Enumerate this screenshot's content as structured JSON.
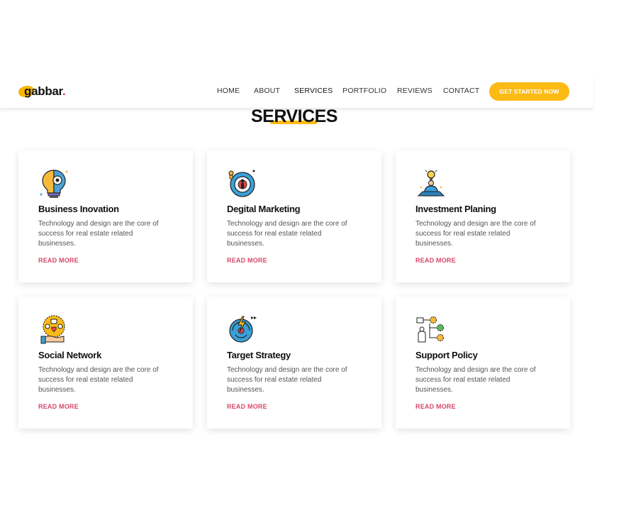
{
  "brand": {
    "name": "gabbar",
    "dot": ".",
    "accent": "#fcbb14"
  },
  "nav": {
    "items": [
      {
        "label": "HOME"
      },
      {
        "label": "ABOUT"
      },
      {
        "label": "SERVICES"
      },
      {
        "label": "PORTFOLIO"
      },
      {
        "label": "REVIEWS"
      },
      {
        "label": "CONTACT"
      }
    ],
    "cta_label": "GET STARTED NOW"
  },
  "services": {
    "title": "SERVICES",
    "cards": [
      {
        "title": "Business Inovation",
        "description": "Technology and design are the core of success for real estate related businesses.",
        "link": "READ MORE",
        "icon": "lightbulb-gear-icon"
      },
      {
        "title": "Degital Marketing",
        "description": "Technology and design are the core of success for real estate related businesses.",
        "link": "READ MORE",
        "icon": "target-person-icon"
      },
      {
        "title": "Investment Planing",
        "description": "Technology and design are the core of success for real estate related businesses.",
        "link": "READ MORE",
        "icon": "meditating-idea-icon"
      },
      {
        "title": "Social Network",
        "description": "Technology and design are the core of success for real estate related businesses.",
        "link": "READ MORE",
        "icon": "social-hand-icon"
      },
      {
        "title": "Target Strategy",
        "description": "Technology and design are the core of success for real estate related businesses.",
        "link": "READ MORE",
        "icon": "target-bolt-icon"
      },
      {
        "title": "Support Policy",
        "description": "Technology and design are the core of success for real estate related businesses.",
        "link": "READ MORE",
        "icon": "flowchart-gears-icon"
      }
    ]
  }
}
